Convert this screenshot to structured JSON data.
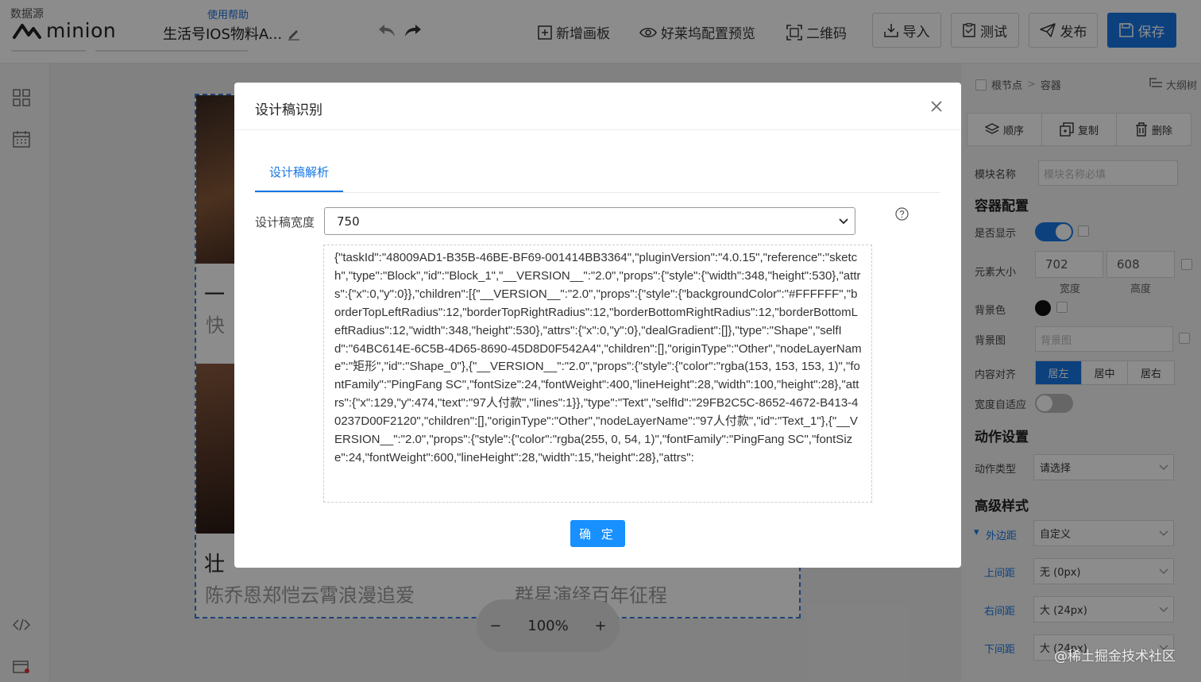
{
  "topbar": {
    "datasource": "数据源",
    "help": "使用帮助",
    "logo": "minion",
    "project_name": "生活号IOS物料A...",
    "tools": [
      "新增画板",
      "好莱坞配置预览",
      "二维码"
    ],
    "buttons": {
      "import": "导入",
      "test": "测试",
      "publish": "发布",
      "save": "保存"
    }
  },
  "card": {
    "left_title": "一",
    "left_sub": "快",
    "bottom_title": "壮",
    "bottom_sub_left": "陈乔恩郑恺云霄浪漫追爱",
    "bottom_sub_right": "群星演绎百年征程"
  },
  "zoom": {
    "value": "100%",
    "minus": "−",
    "plus": "+"
  },
  "right_panel": {
    "crumb_root": "根节点",
    "crumb_sep": ">",
    "crumb_node": "容器",
    "outline": "大纲树",
    "actions": {
      "order": "顺序",
      "copy": "复制",
      "delete": "删除"
    },
    "module_name_label": "模块名称",
    "module_name_placeholder": "模块名称必填",
    "container_heading": "容器配置",
    "show_label": "是否显示",
    "size_label": "元素大小",
    "width_value": "702",
    "height_value": "608",
    "width_caption": "宽度",
    "height_caption": "高度",
    "bg_color_label": "背景色",
    "bg_image_label": "背景图",
    "bg_image_placeholder": "背景图",
    "align_label": "内容对齐",
    "align_options": [
      "居左",
      "居中",
      "居右"
    ],
    "auto_width_label": "宽度自适应",
    "action_heading": "动作设置",
    "action_type_label": "动作类型",
    "action_type_value": "请选择",
    "advanced_heading": "高级样式",
    "margin_label": "外边距",
    "margin_value": "自定义",
    "top_margin_label": "上间距",
    "top_margin_value": "无 (0px)",
    "right_margin_label": "右间距",
    "right_margin_value": "大 (24px)",
    "bottom_margin_label": "下间距",
    "bottom_margin_value": "大 (24px)"
  },
  "watermark": "@稀土掘金技术社区",
  "modal": {
    "title": "设计稿识别",
    "tab": "设计稿解析",
    "width_label": "设计稿宽度",
    "width_value": "750",
    "json_text": "{\"taskId\":\"48009AD1-B35B-46BE-BF69-001414BB3364\",\"pluginVersion\":\"4.0.15\",\"reference\":\"sketch\",\"type\":\"Block\",\"id\":\"Block_1\",\"__VERSION__\":\"2.0\",\"props\":{\"style\":{\"width\":348,\"height\":530},\"attrs\":{\"x\":0,\"y\":0}},\"children\":[{\"__VERSION__\":\"2.0\",\"props\":{\"style\":{\"backgroundColor\":\"#FFFFFF\",\"borderTopLeftRadius\":12,\"borderTopRightRadius\":12,\"borderBottomRightRadius\":12,\"borderBottomLeftRadius\":12,\"width\":348,\"height\":530},\"attrs\":{\"x\":0,\"y\":0},\"dealGradient\":[]},\"type\":\"Shape\",\"selfId\":\"64BC614E-6C5B-4D65-8690-45D8D0F542A4\",\"children\":[],\"originType\":\"Other\",\"nodeLayerName\":\"矩形\",\"id\":\"Shape_0\"},{\"__VERSION__\":\"2.0\",\"props\":{\"style\":{\"color\":\"rgba(153, 153, 153, 1)\",\"fontFamily\":\"PingFang SC\",\"fontSize\":24,\"fontWeight\":400,\"lineHeight\":28,\"width\":100,\"height\":28},\"attrs\":{\"x\":129,\"y\":474,\"text\":\"97人付款\",\"lines\":1}},\"type\":\"Text\",\"selfId\":\"29FB2C5C-8652-4672-B413-40237D00F2120\",\"children\":[],\"originType\":\"Other\",\"nodeLayerName\":\"97人付款\",\"id\":\"Text_1\"},{\"__VERSION__\":\"2.0\",\"props\":{\"style\":{\"color\":\"rgba(255, 0, 54, 1)\",\"fontFamily\":\"PingFang SC\",\"fontSize\":24,\"fontWeight\":600,\"lineHeight\":28,\"width\":15,\"height\":28},\"attrs\":",
    "ok": "确 定"
  },
  "colors": {
    "primary": "#1677e5",
    "link": "#1890ff"
  }
}
